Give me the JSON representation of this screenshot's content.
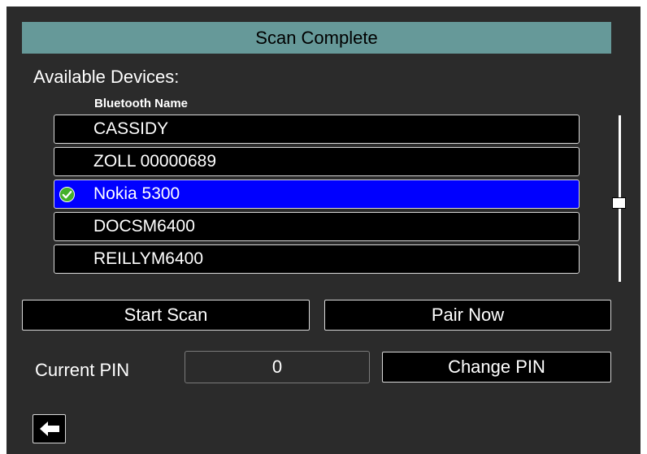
{
  "header": {
    "title": "Scan Complete"
  },
  "devices": {
    "section_label": "Available Devices:",
    "column_header": "Bluetooth Name",
    "items": [
      {
        "name": "CASSIDY",
        "selected": false
      },
      {
        "name": "ZOLL 00000689",
        "selected": false
      },
      {
        "name": "Nokia 5300",
        "selected": true
      },
      {
        "name": "DOCSM6400",
        "selected": false
      },
      {
        "name": "REILLYM6400",
        "selected": false
      }
    ]
  },
  "actions": {
    "start_scan_label": "Start Scan",
    "pair_now_label": "Pair Now",
    "change_pin_label": "Change PIN"
  },
  "pin": {
    "label": "Current PIN",
    "value": "0"
  },
  "icons": {
    "selected_check": "check-circle-icon",
    "back": "back-arrow-icon"
  },
  "colors": {
    "background": "#2b2b2b",
    "title_bar": "#669999",
    "selected_row": "#0000ff",
    "row": "#000000",
    "check": "#44b02a"
  }
}
